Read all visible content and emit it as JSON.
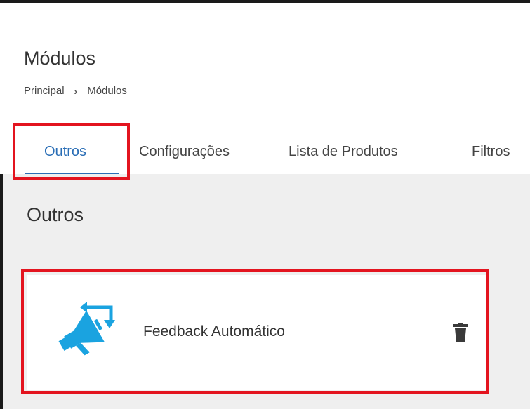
{
  "header": {
    "title": "Módulos",
    "breadcrumb": {
      "home": "Principal",
      "separator": "›",
      "current": "Módulos"
    }
  },
  "tabs": [
    {
      "label": "Outros",
      "active": true
    },
    {
      "label": "Configurações",
      "active": false
    },
    {
      "label": "Lista de Produtos",
      "active": false
    },
    {
      "label": "Filtros",
      "active": false
    }
  ],
  "section": {
    "title": "Outros",
    "modules": [
      {
        "name": "Feedback Automático",
        "icon": "megaphone-feedback-icon",
        "action_icon": "trash-icon"
      }
    ]
  },
  "colors": {
    "accent": "#2a6eb6",
    "highlight": "#e3141f",
    "icon_blue": "#1aa3e0",
    "content_bg": "#efefef"
  }
}
